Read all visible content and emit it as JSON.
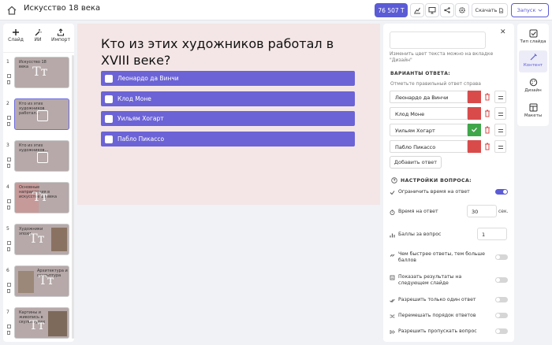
{
  "header": {
    "title": "Искусство 18 века",
    "credits": "76 507 Т",
    "download": "Скачать",
    "launch": "Запуск"
  },
  "tools": [
    {
      "label": "Слайд",
      "icon": "plus-icon"
    },
    {
      "label": "ИИ",
      "icon": "magic-wand-icon"
    },
    {
      "label": "Импорт",
      "icon": "import-icon"
    }
  ],
  "slides": [
    {
      "num": "1",
      "text": "Искусство 18 века"
    },
    {
      "num": "2",
      "text": "Кто из этих художников работал..."
    },
    {
      "num": "3",
      "text": "Кто из этих художников..."
    },
    {
      "num": "4",
      "text": "Основные направления в искусстве 18 века"
    },
    {
      "num": "5",
      "text": "Художники эпохи"
    },
    {
      "num": "6",
      "text": "Архитектура и скульптура"
    },
    {
      "num": "7",
      "text": "Картины и живопись в скульптурах"
    }
  ],
  "slide": {
    "question": "Кто из этих художников работал в XVIII веке?",
    "options": [
      "Леонардо да Винчи",
      "Клод Моне",
      "Уильям Хогарт",
      "Пабло Пикассо"
    ]
  },
  "panel": {
    "hint": "Изменить цвет текста можно на вкладке \"Дизайн\"",
    "answers_title": "ВАРИАНТЫ ОТВЕТА:",
    "mark_hint": "Отметьте правильный ответ справа",
    "answers": [
      {
        "text": "Леонардо да Винчи",
        "correct": false
      },
      {
        "text": "Клод Моне",
        "correct": false
      },
      {
        "text": "Уильям Хогарт",
        "correct": true
      },
      {
        "text": "Пабло Пикассо",
        "correct": false
      }
    ],
    "add_answer": "Добавить ответ",
    "settings_title": "НАСТРОЙКИ ВОПРОСА:",
    "limit_time": "Ограничить время на ответ",
    "limit_time_on": true,
    "answer_time_label": "Время на ответ",
    "answer_time": "30",
    "answer_time_unit": "сек.",
    "points_label": "Баллы за вопрос",
    "points": "1",
    "faster_more": "Чем быстрее ответы, тем больше баллов",
    "faster_more_on": false,
    "show_results": "Показать результаты на следующем слайде",
    "show_results_on": false,
    "single_answer": "Разрешить только один ответ",
    "single_answer_on": false,
    "shuffle": "Перемешать порядок ответов",
    "shuffle_on": false,
    "allow_skip": "Разрешить пропускать вопрос",
    "allow_skip_on": false
  },
  "right_tabs": [
    {
      "label": "Тип слайда",
      "icon": "slide-type-icon"
    },
    {
      "label": "Контент",
      "icon": "content-icon",
      "active": true
    },
    {
      "label": "Дизайн",
      "icon": "palette-icon"
    },
    {
      "label": "Макеты",
      "icon": "layout-icon"
    }
  ],
  "colors": {
    "accent": "#5b5bd6",
    "option": "#6c63d6",
    "canvas": "#f4e6e6",
    "wrong": "#d94b4b",
    "correct": "#3fa64a"
  }
}
